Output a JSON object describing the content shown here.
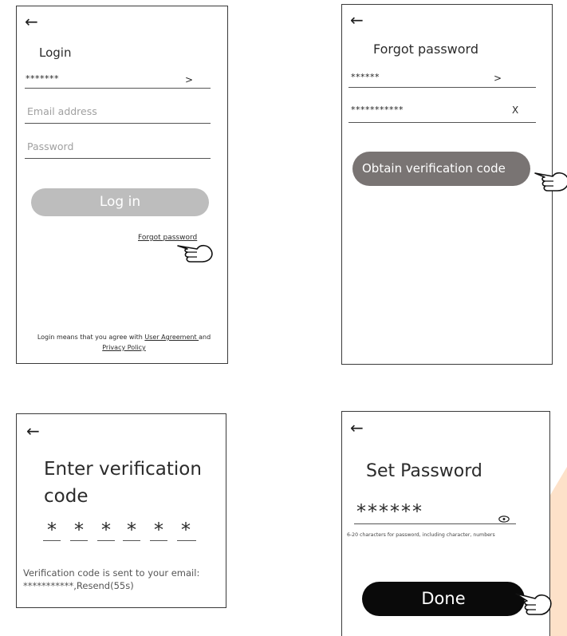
{
  "colors": {
    "accent_peach": "#fde1c9",
    "button_gray": "#bdbdbd",
    "button_dark": "#797473",
    "button_black": "#0a0a0a"
  },
  "login_screen": {
    "back_icon": "left-arrow-icon",
    "title": "Login",
    "account_value": "*******",
    "chevron": ">",
    "email_placeholder": "Email address",
    "password_placeholder": "Password",
    "login_button": "Log in",
    "forgot_link": "Forgot password",
    "agreement_prefix": "Login means that you agree with ",
    "user_agreement": "User Agreement ",
    "agreement_and": "and",
    "privacy_policy": "Privacy Policy "
  },
  "forgot_screen": {
    "back_icon": "left-arrow-icon",
    "title": "Forgot password",
    "region_value": "******",
    "chevron": ">",
    "email_value": "***********",
    "clear": "X",
    "obtain_button": "Obtain verification code"
  },
  "verify_screen": {
    "back_icon": "left-arrow-icon",
    "title_line1": "Enter verification",
    "title_line2": "code",
    "digits": [
      "*",
      "*",
      "*",
      "*",
      "*",
      "*"
    ],
    "sent_line1": "Verification code is sent to your email:",
    "sent_line2": "***********,Resend(55s)"
  },
  "setpw_screen": {
    "back_icon": "left-arrow-icon",
    "title": "Set Password",
    "password_value": "******",
    "eye_icon": "eye-icon",
    "hint": "6-20 characters for password, including character, numbers",
    "done_button": "Done"
  }
}
